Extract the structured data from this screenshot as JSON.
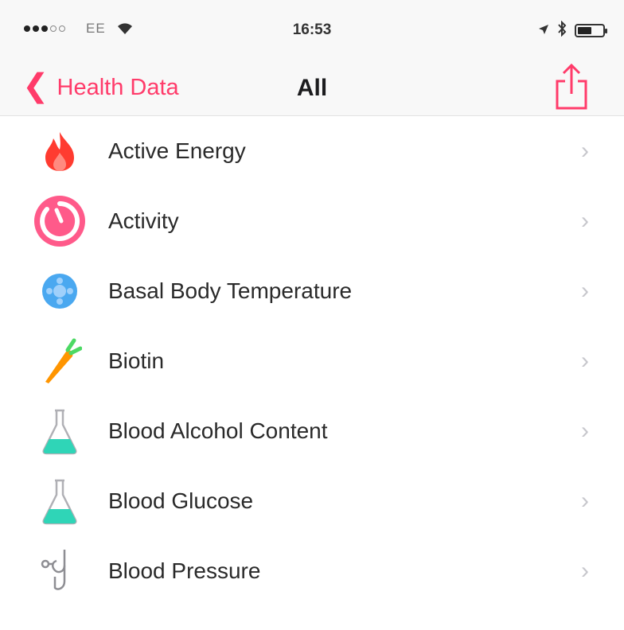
{
  "status_bar": {
    "carrier": "EE",
    "time": "16:53",
    "battery_level": 0.55
  },
  "nav": {
    "back_label": "Health Data",
    "title": "All"
  },
  "colors": {
    "accent": "#ff3b6a",
    "chevron": "#c7c7cc"
  },
  "items": [
    {
      "label": "Active Energy",
      "icon": "flame-icon",
      "color": "#ff3b30"
    },
    {
      "label": "Activity",
      "icon": "activity-ring-icon",
      "color": "#ff5a8a"
    },
    {
      "label": "Basal Body Temperature",
      "icon": "temperature-flower-icon",
      "color": "#4aa8f0"
    },
    {
      "label": "Biotin",
      "icon": "carrot-icon",
      "color": "#ff9500"
    },
    {
      "label": "Blood Alcohol Content",
      "icon": "flask-icon",
      "color": "#2fd5b7"
    },
    {
      "label": "Blood Glucose",
      "icon": "flask-icon",
      "color": "#2fd5b7"
    },
    {
      "label": "Blood Pressure",
      "icon": "stethoscope-icon",
      "color": "#8e8e93"
    }
  ]
}
